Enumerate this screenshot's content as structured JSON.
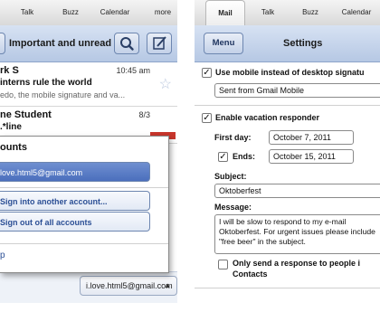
{
  "left_screen": {
    "tabs": [
      "Talk",
      "Buzz",
      "Calendar",
      "more"
    ],
    "navbar": {
      "title": "Important and unread",
      "search_icon": "search-icon",
      "compose_icon": "compose-icon"
    },
    "messages": [
      {
        "from": "rk S",
        "time": "10:45 am",
        "subject": "interns rule the world",
        "snippet": "edo, the mobile signature and va..."
      },
      {
        "from": "ne Student",
        "time": "8/3",
        "subject": ".*line",
        "snippet": ""
      }
    ],
    "accounts_popup": {
      "title": "ounts",
      "current_account": "love.html5@gmail.com",
      "options": [
        "Sign into another account...",
        "Sign out of all accounts"
      ],
      "help": "p"
    },
    "account_switcher": "i.love.html5@gmail.com"
  },
  "right_screen": {
    "tabs": [
      "Mail",
      "Talk",
      "Buzz",
      "Calendar"
    ],
    "navbar": {
      "menu_button": "Menu",
      "title": "Settings"
    },
    "signature": {
      "checked": true,
      "label": "Use mobile instead of desktop signatu",
      "value": "Sent from Gmail Mobile"
    },
    "vacation": {
      "checked": true,
      "label": "Enable vacation responder",
      "first_day_label": "First day:",
      "first_day": "October 7, 2011",
      "ends_checked": true,
      "ends_label": "Ends:",
      "ends": "October 15, 2011",
      "subject_label": "Subject:",
      "subject": "Oktoberfest",
      "message_label": "Message:",
      "message": "I will be slow to respond to my e-mail Oktoberfest. For urgent issues please include \"free beer\" in the subject.",
      "only_contacts_checked": false,
      "only_contacts_label": "Only send a response to people i",
      "only_contacts_label_2": "Contacts"
    }
  }
}
